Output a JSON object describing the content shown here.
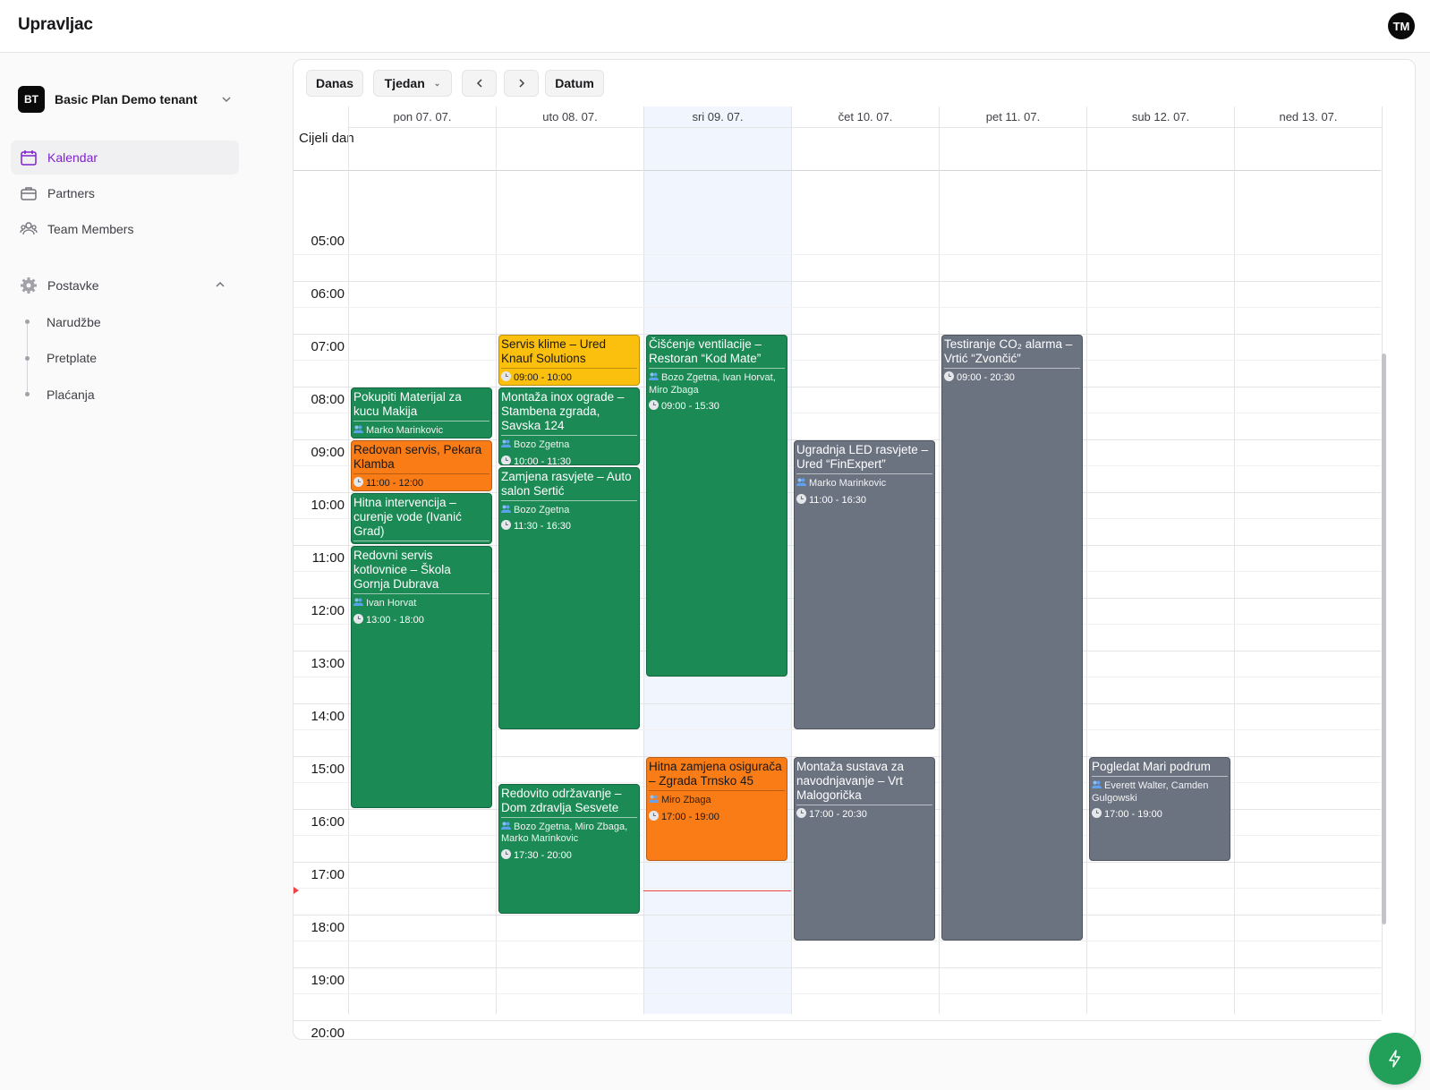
{
  "app": {
    "title": "Upravljac",
    "avatar_initials": "TM"
  },
  "sidebar": {
    "tenant": {
      "initials": "BT",
      "name": "Basic Plan Demo tenant"
    },
    "items": [
      {
        "label": "Kalendar",
        "icon": "calendar-icon",
        "active": true
      },
      {
        "label": "Partners",
        "icon": "briefcase-icon",
        "active": false
      },
      {
        "label": "Team Members",
        "icon": "users-icon",
        "active": false
      }
    ],
    "settings": {
      "label": "Postavke",
      "icon": "gear-icon",
      "expanded": true,
      "children": [
        "Narudžbe",
        "Pretplate",
        "Plaćanja"
      ]
    }
  },
  "toolbar": {
    "today": "Danas",
    "view": "Tjedan",
    "prev": "‹",
    "next": "›",
    "date": "Datum"
  },
  "calendar": {
    "allday_label": "Cijeli dan",
    "today_index": 2,
    "days": [
      "pon 07. 07.",
      "uto 08. 07.",
      "sri 09. 07.",
      "čet 10. 07.",
      "pet 11. 07.",
      "sub 12. 07.",
      "ned 13. 07."
    ],
    "hours": [
      "05:00",
      "06:00",
      "07:00",
      "08:00",
      "09:00",
      "10:00",
      "11:00",
      "12:00",
      "13:00",
      "14:00",
      "15:00",
      "16:00",
      "17:00",
      "18:00",
      "19:00",
      "20:00"
    ],
    "events": [
      {
        "day": 0,
        "color": "green",
        "title": "Pokupiti Materijal za kucu Makija",
        "people": "Marko Marinkovic",
        "time": "",
        "start": "08:00",
        "end": "09:00"
      },
      {
        "day": 0,
        "color": "orange",
        "title": "Redovan servis, Pekara Klamba",
        "people": "",
        "time": "11:00 - 12:00",
        "start": "09:00",
        "end": "10:00"
      },
      {
        "day": 0,
        "color": "green",
        "title": "Hitna intervencija – curenje vode (Ivanić Grad)",
        "people": "",
        "time": "",
        "start": "10:00",
        "end": "11:00"
      },
      {
        "day": 0,
        "color": "green",
        "title": "Redovni servis kotlovnice – Škola Gornja Dubrava",
        "people": "Ivan Horvat",
        "time": "13:00 - 18:00",
        "start": "11:00",
        "end": "16:00"
      },
      {
        "day": 1,
        "color": "yellow",
        "title": "Servis klime – Ured Knauf Solutions",
        "people": "",
        "time": "09:00 - 10:00",
        "start": "07:00",
        "end": "08:00"
      },
      {
        "day": 1,
        "color": "green",
        "title": "Montaža inox ograde – Stambena zgrada, Savska 124",
        "people": "Bozo Zgetna",
        "time": "10:00 - 11:30",
        "start": "08:00",
        "end": "09:30"
      },
      {
        "day": 1,
        "color": "green",
        "title": "Zamjena rasvjete – Auto salon Sertić",
        "people": "Bozo Zgetna",
        "time": "11:30 - 16:30",
        "start": "09:30",
        "end": "14:30"
      },
      {
        "day": 1,
        "color": "green",
        "title": "Redovito održavanje – Dom zdravlja Sesvete",
        "people": "Bozo Zgetna, Miro Zbaga, Marko Marinkovic",
        "time": "17:30 - 20:00",
        "start": "15:30",
        "end": "18:00"
      },
      {
        "day": 2,
        "color": "green",
        "title": "Čišćenje ventilacije – Restoran “Kod Mate”",
        "people": "Bozo Zgetna, Ivan Horvat, Miro Zbaga",
        "time": "09:00 - 15:30",
        "start": "07:00",
        "end": "13:30"
      },
      {
        "day": 2,
        "color": "orange",
        "title": "Hitna zamjena osigurača – Zgrada Trnsko 45",
        "people": "Miro Zbaga",
        "time": "17:00 - 19:00",
        "start": "15:00",
        "end": "17:00"
      },
      {
        "day": 3,
        "color": "gray",
        "title": "Ugradnja LED rasvjete – Ured “FinExpert”",
        "people": "Marko Marinkovic",
        "time": "11:00 - 16:30",
        "start": "09:00",
        "end": "14:30"
      },
      {
        "day": 3,
        "color": "gray",
        "title": "Montaža sustava za navodnjavanje – Vrt Malogorička",
        "people": "",
        "time": "17:00 - 20:30",
        "start": "15:00",
        "end": "18:30"
      },
      {
        "day": 4,
        "color": "gray",
        "title": "Testiranje CO₂ alarma – Vrtić “Zvončić”",
        "people": "",
        "time": "09:00 - 20:30",
        "start": "07:00",
        "end": "18:30"
      },
      {
        "day": 5,
        "color": "gray",
        "title": "Pogledat Mari podrum",
        "people": "Everett Walter, Camden Gulgowski",
        "time": "17:00 - 19:00",
        "start": "15:00",
        "end": "17:00"
      }
    ],
    "now_time": "17:33"
  },
  "colors": {
    "accent": "#7e22ce",
    "event_green": "#1b8a55",
    "event_yellow": "#fbbf0e",
    "event_orange": "#f97c16",
    "event_gray": "#6b7280",
    "now_line": "#ef4444",
    "fab": "#22a05a"
  },
  "fab_icon": "lightning-icon"
}
